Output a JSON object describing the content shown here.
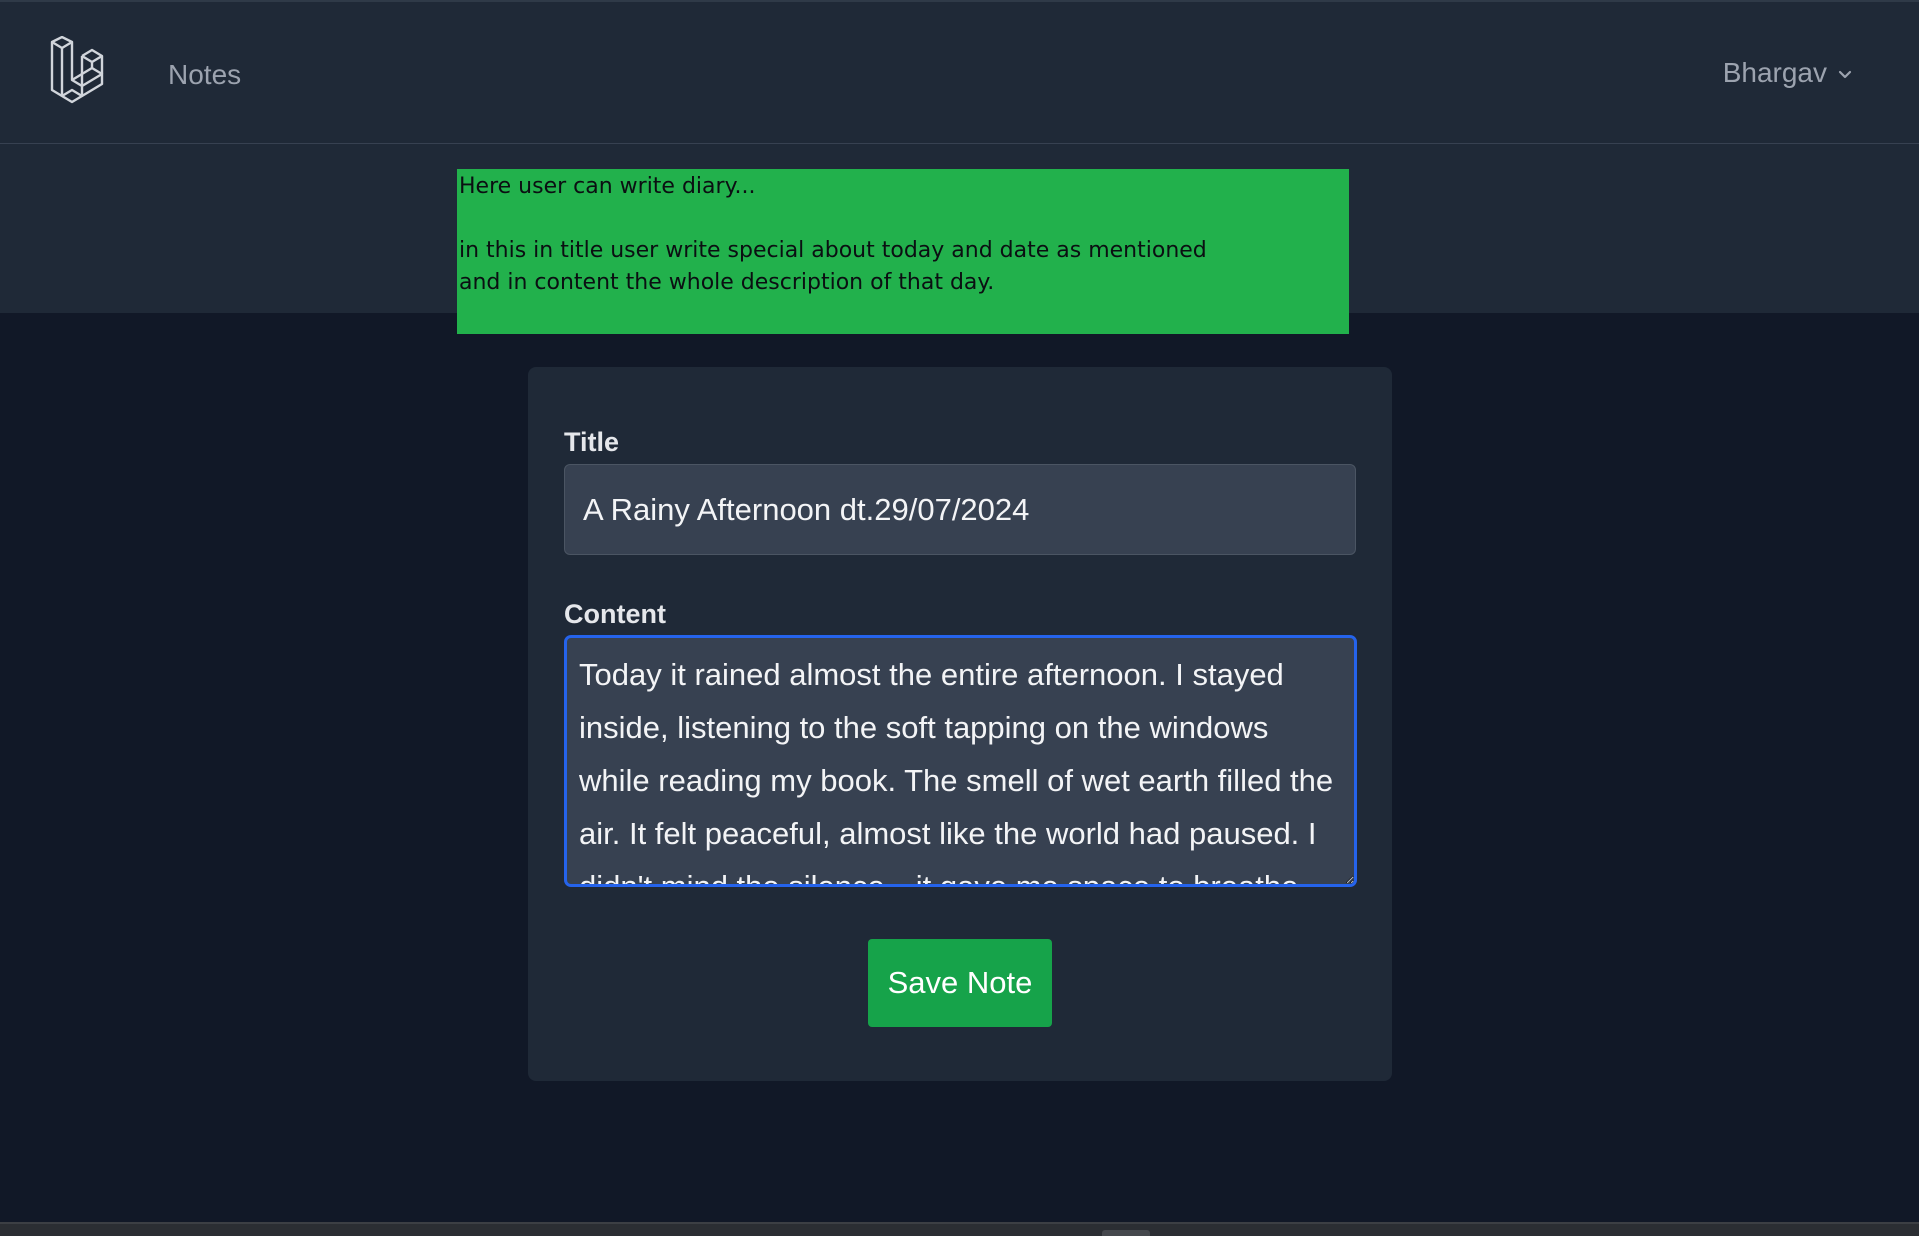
{
  "nav": {
    "logo_icon": "laravel-logo-icon",
    "link_label": "Notes",
    "user_name": "Bhargav",
    "user_menu_icon": "chevron-down-icon"
  },
  "annotation": {
    "line1": "Here user can write diary...",
    "line2": "in this in title user write special about today and date as mentioned",
    "line3": "and in content the whole description of that day.",
    "background": "#22b14c"
  },
  "form": {
    "title_label": "Title",
    "title_value": "A Rainy Afternoon dt.29/07/2024",
    "content_label": "Content",
    "content_value": "Today it rained almost the entire afternoon. I stayed inside, listening to the soft tapping on the windows while reading my book. The smell of wet earth filled the air. It felt peaceful, almost like the world had paused. I didn't mind the silence—it gave me space to breathe.",
    "submit_label": "Save Note"
  },
  "colors": {
    "page_bg": "#111827",
    "panel_bg": "#1f2937",
    "input_bg": "#374151",
    "focus_border": "#2563eb",
    "button_bg": "#16a34a"
  }
}
